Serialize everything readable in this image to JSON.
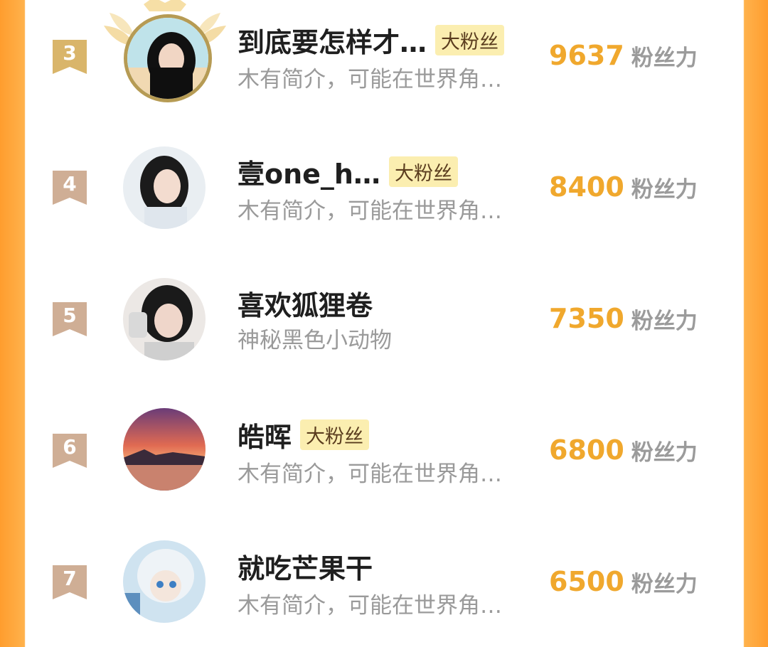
{
  "leaderboard": {
    "rows": [
      {
        "rank": "3",
        "name": "到底要怎样才…",
        "tag": "大粉丝",
        "bio": "木有简介，可能在世界角…",
        "score": "9637",
        "unit": "粉丝力"
      },
      {
        "rank": "4",
        "name": "壹one_h…",
        "tag": "大粉丝",
        "bio": "木有简介，可能在世界角…",
        "score": "8400",
        "unit": "粉丝力"
      },
      {
        "rank": "5",
        "name": "喜欢狐狸卷",
        "tag": "",
        "bio": "神秘黑色小动物",
        "score": "7350",
        "unit": "粉丝力"
      },
      {
        "rank": "6",
        "name": "皓晖",
        "tag": "大粉丝",
        "bio": "木有简介，可能在世界角…",
        "score": "6800",
        "unit": "粉丝力"
      },
      {
        "rank": "7",
        "name": "就吃芒果干",
        "tag": "",
        "bio": "木有简介，可能在世界角…",
        "score": "6500",
        "unit": "粉丝力"
      }
    ]
  },
  "colors": {
    "side_accent": "#ff9d2e",
    "score": "#f0a82d",
    "tag_bg": "#fbeeb0",
    "rank3_badge": "#d9b56a",
    "rank_badge": "#cfae95"
  },
  "icons": {
    "rank_badge": "ribbon-badge-icon",
    "crown": "crown-laurel-icon"
  }
}
